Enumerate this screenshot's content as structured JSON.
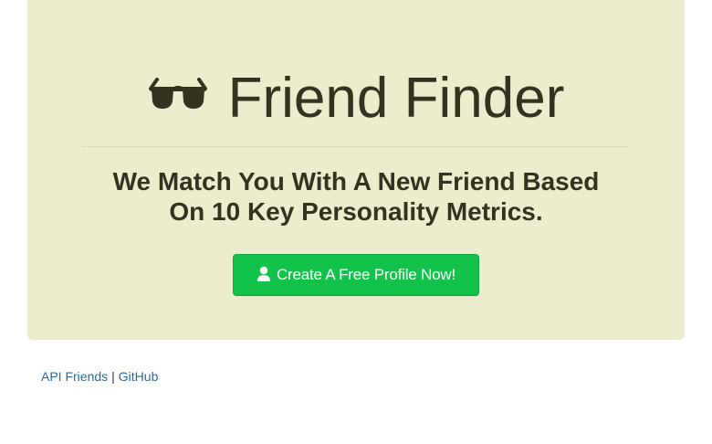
{
  "hero": {
    "icon": "sunglasses-icon",
    "title": "Friend Finder",
    "tagline_line1": "We Match You With A New Friend Based",
    "tagline_line2": "On 10 Key Personality Metrics.",
    "cta": {
      "icon": "user-icon",
      "label": "Create A Free Profile Now!"
    }
  },
  "footer": {
    "link_api": "API Friends",
    "separator": "|",
    "link_github": "GitHub"
  },
  "colors": {
    "jumbotron_bg": "#ecedce",
    "heading_text": "#35331f",
    "cta_bg": "#13c24a",
    "link": "#2a6aa0"
  }
}
